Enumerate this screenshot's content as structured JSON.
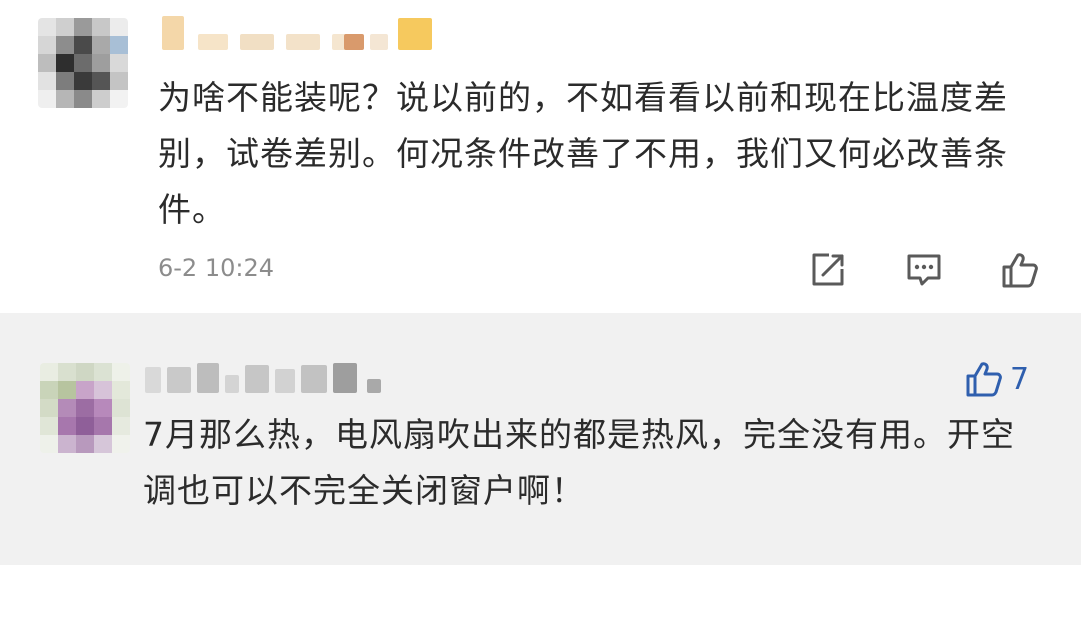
{
  "comments": [
    {
      "text": "为啥不能装呢？说以前的，不如看看以前和现在比温度差别，试卷差别。何况条件改善了不用，我们又何必改善条件。",
      "timestamp": "6-2 10:24",
      "actions": {
        "share_icon": "share-icon",
        "reply_icon": "comment-icon",
        "like_icon": "thumbs-up-icon"
      }
    },
    {
      "text": "7月那么热，电风扇吹出来的都是热风，完全没有用。开空调也可以不完全关闭窗户啊！",
      "like_count": "7",
      "like_icon": "thumbs-up-icon"
    }
  ],
  "colors": {
    "text": "#2b2b2b",
    "meta": "#8c8c8c",
    "icon": "#5a5a5a",
    "accent": "#2f5fae",
    "reply_background": "#f1f1f1"
  }
}
